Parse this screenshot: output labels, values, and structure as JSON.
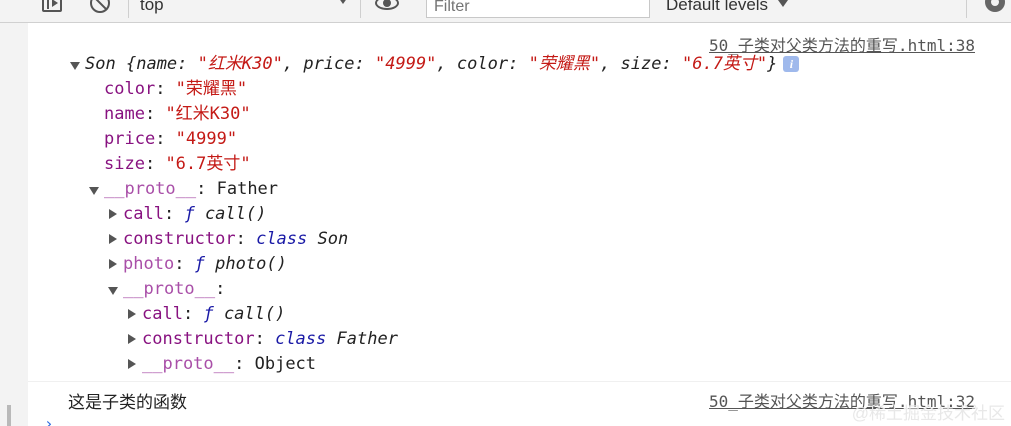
{
  "toolbar": {
    "context": "top",
    "filter_placeholder": "Filter",
    "levels_label": "Default levels"
  },
  "messages": {
    "obj_log": {
      "source": "50_子类对父类方法的重写.html:38",
      "summary": {
        "class_name": "Son",
        "open": "{",
        "name_key": "name",
        "name_val": "\"红米K30\"",
        "price_key": "price",
        "price_val": "\"4999\"",
        "color_key": "color",
        "color_val": "\"荣耀黑\"",
        "size_key": "size",
        "size_val": "\"6.7英寸\"",
        "close": "}",
        "info_icon": "info-icon"
      },
      "props": [
        {
          "key": "color",
          "value": "\"荣耀黑\""
        },
        {
          "key": "name",
          "value": "\"红米K30\""
        },
        {
          "key": "price",
          "value": "\"4999\""
        },
        {
          "key": "size",
          "value": "\"6.7英寸\""
        }
      ],
      "proto": {
        "key": "__proto__",
        "value": "Father",
        "items": [
          {
            "key": "call",
            "f": "ƒ",
            "sig": "call()"
          },
          {
            "key": "constructor",
            "cls": "class",
            "sig": "Son"
          },
          {
            "key": "photo",
            "f": "ƒ",
            "sig": "photo()"
          }
        ],
        "inner": {
          "key": "__proto__",
          "items": [
            {
              "key": "call",
              "f": "ƒ",
              "sig": "call()"
            },
            {
              "key": "constructor",
              "cls": "class",
              "sig": "Father"
            },
            {
              "key": "__proto__",
              "value": "Object"
            }
          ]
        }
      }
    },
    "text_log": {
      "text": "这是子类的函数",
      "source": "50_子类对父类方法的重写.html:32"
    }
  },
  "watermark": "@稀土掘金技术社区"
}
